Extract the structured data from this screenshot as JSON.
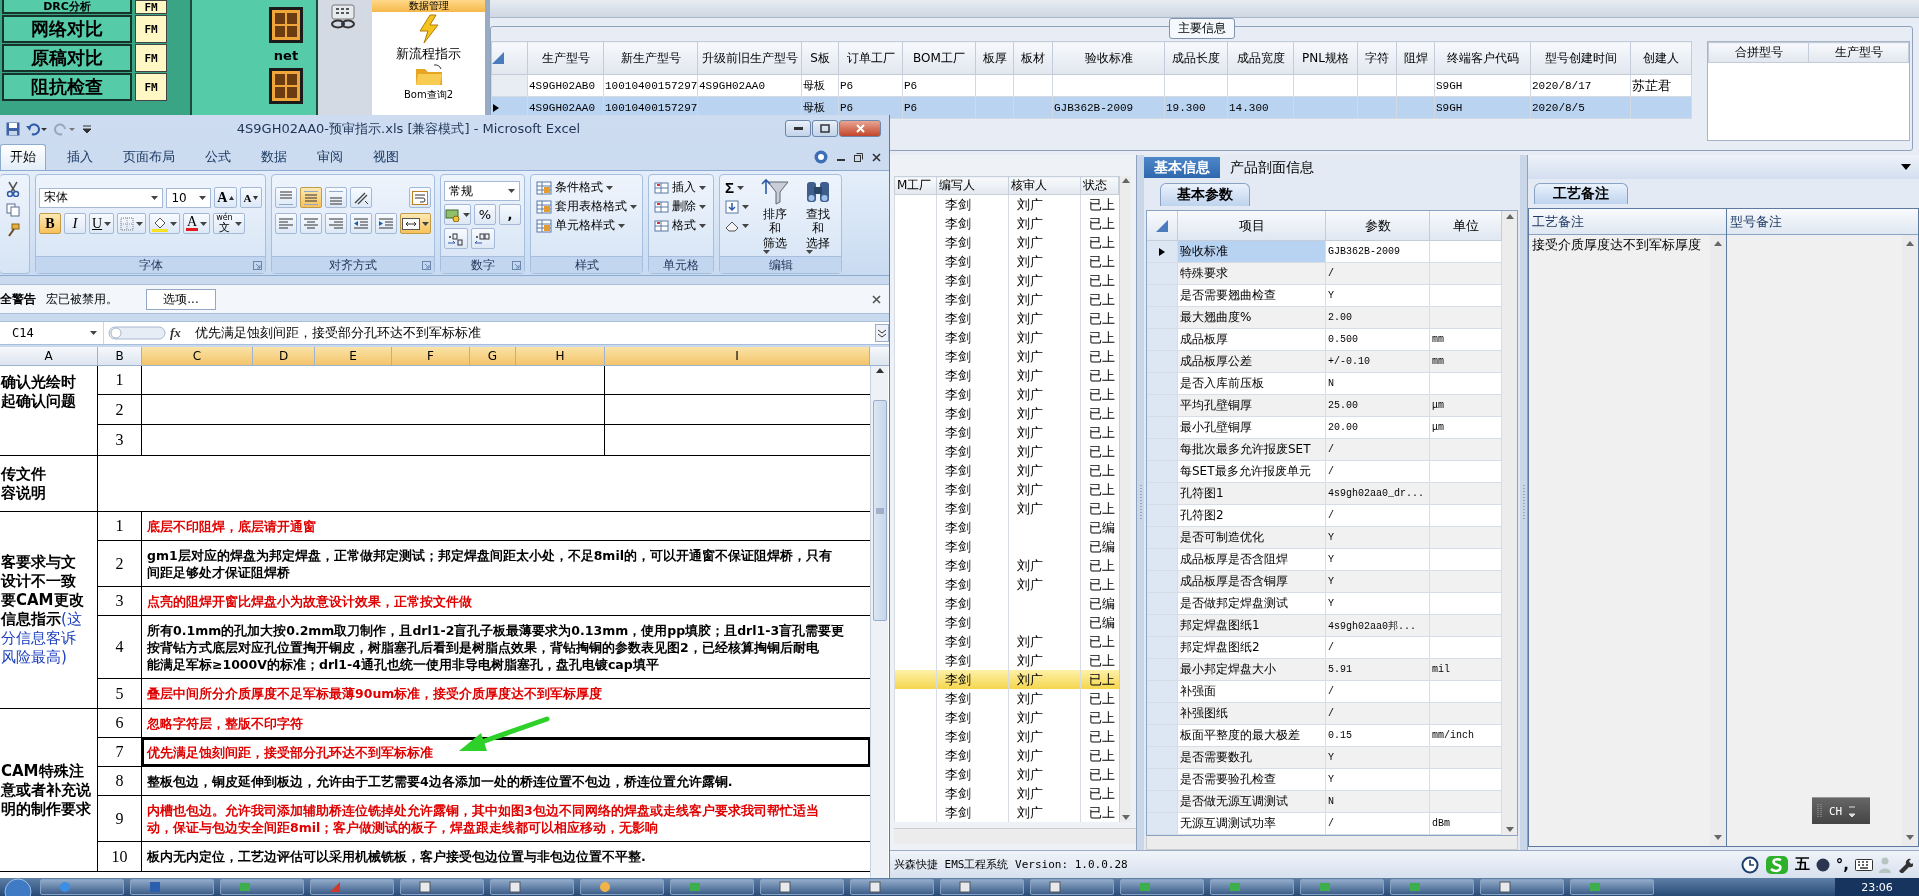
{
  "nav": {
    "items": [
      {
        "label": "DRC分析",
        "badge": "FM"
      },
      {
        "label": "网络对比",
        "badge": "FM"
      },
      {
        "label": "原稿对比",
        "badge": "FM"
      },
      {
        "label": "阻抗检查",
        "badge": "FM"
      }
    ]
  },
  "net_panel": {
    "label": "net"
  },
  "function_menu": {
    "header": "数据管理",
    "items": [
      {
        "label": "新流程指示",
        "kind": "flow"
      },
      {
        "label": "Bom查询2",
        "kind": "folder"
      }
    ]
  },
  "main_info": {
    "title": "主要信息",
    "columns": [
      "生产型号",
      "新生产型号",
      "升级前旧生产型号",
      "S板",
      "订单工厂",
      "BOM工厂",
      "板厚",
      "板材",
      "验收标准",
      "成品长度",
      "成品宽度",
      "PNL规格",
      "字符",
      "阻焊",
      "终端客户代码",
      "型号创建时间",
      "创建人"
    ],
    "rows": [
      {
        "selected": false,
        "cells": [
          "4S9GH02AB0",
          "10010400157297",
          "4S9GH02AA0",
          "母板",
          "P6",
          "P6",
          null,
          null,
          null,
          null,
          null,
          null,
          null,
          null,
          "S9GH",
          "2020/8/17",
          "苏芷君"
        ]
      },
      {
        "selected": true,
        "cells": [
          "4S9GH02AA0",
          "10010400157297",
          null,
          "母板",
          "P6",
          "P6",
          null,
          null,
          "GJB362B-2009",
          "19.300",
          "14.300",
          null,
          null,
          null,
          "S9GH",
          "2020/8/5",
          null
        ]
      }
    ]
  },
  "merge_panel": {
    "columns": [
      "合拼型号",
      "生产型号"
    ]
  },
  "list": {
    "columns": [
      "M工厂",
      "编写人",
      "核审人",
      "状态"
    ],
    "rows": [
      {
        "writer": "李剑",
        "reviewer": "刘广",
        "status": "已上",
        "selected": false
      },
      {
        "writer": "李剑",
        "reviewer": "刘广",
        "status": "已上",
        "selected": false
      },
      {
        "writer": "李剑",
        "reviewer": "刘广",
        "status": "已上",
        "selected": false
      },
      {
        "writer": "李剑",
        "reviewer": "刘广",
        "status": "已上",
        "selected": false
      },
      {
        "writer": "李剑",
        "reviewer": "刘广",
        "status": "已上",
        "selected": false
      },
      {
        "writer": "李剑",
        "reviewer": "刘广",
        "status": "已上",
        "selected": false
      },
      {
        "writer": "李剑",
        "reviewer": "刘广",
        "status": "已上",
        "selected": false
      },
      {
        "writer": "李剑",
        "reviewer": "刘广",
        "status": "已上",
        "selected": false
      },
      {
        "writer": "李剑",
        "reviewer": "刘广",
        "status": "已上",
        "selected": false
      },
      {
        "writer": "李剑",
        "reviewer": "刘广",
        "status": "已上",
        "selected": false
      },
      {
        "writer": "李剑",
        "reviewer": "刘广",
        "status": "已上",
        "selected": false
      },
      {
        "writer": "李剑",
        "reviewer": "刘广",
        "status": "已上",
        "selected": false
      },
      {
        "writer": "李剑",
        "reviewer": "刘广",
        "status": "已上",
        "selected": false
      },
      {
        "writer": "李剑",
        "reviewer": "刘广",
        "status": "已上",
        "selected": false
      },
      {
        "writer": "李剑",
        "reviewer": "刘广",
        "status": "已上",
        "selected": false
      },
      {
        "writer": "李剑",
        "reviewer": "刘广",
        "status": "已上",
        "selected": false
      },
      {
        "writer": "李剑",
        "reviewer": "刘广",
        "status": "已上",
        "selected": false
      },
      {
        "writer": "李剑",
        "status": "已编",
        "selected": false
      },
      {
        "writer": "李剑",
        "status": "已编",
        "selected": false
      },
      {
        "writer": "李剑",
        "reviewer": "刘广",
        "status": "已上",
        "selected": false
      },
      {
        "writer": "李剑",
        "reviewer": "刘广",
        "status": "已上",
        "selected": false
      },
      {
        "writer": "李剑",
        "status": "已编",
        "selected": false
      },
      {
        "writer": "李剑",
        "status": "已编",
        "selected": false
      },
      {
        "writer": "李剑",
        "reviewer": "刘广",
        "status": "已上",
        "selected": false
      },
      {
        "writer": "李剑",
        "reviewer": "刘广",
        "status": "已上",
        "selected": false
      },
      {
        "writer": "李剑",
        "reviewer": "刘广",
        "status": "已上",
        "selected": true
      },
      {
        "writer": "李剑",
        "reviewer": "刘广",
        "status": "已上",
        "selected": false
      },
      {
        "writer": "李剑",
        "reviewer": "刘广",
        "status": "已上",
        "selected": false
      },
      {
        "writer": "李剑",
        "reviewer": "刘广",
        "status": "已上",
        "selected": false
      },
      {
        "writer": "李剑",
        "reviewer": "刘广",
        "status": "已上",
        "selected": false
      },
      {
        "writer": "李剑",
        "reviewer": "刘广",
        "status": "已上",
        "selected": false
      },
      {
        "writer": "李剑",
        "reviewer": "刘广",
        "status": "已上",
        "selected": false
      },
      {
        "writer": "李剑",
        "reviewer": "刘广",
        "status": "已上",
        "selected": false
      }
    ]
  },
  "info_tabs": [
    {
      "label": "基本信息",
      "selected": true
    },
    {
      "label": "产品剖面信息",
      "selected": false
    }
  ],
  "params": {
    "tab": "基本参数",
    "columns": [
      "项目",
      "参数",
      "单位"
    ],
    "rows": [
      {
        "item": "验收标准",
        "value": "GJB362B-2009",
        "selected": true
      },
      {
        "item": "特殊要求",
        "value": "/",
        "selected": false
      },
      {
        "item": "是否需要翘曲检查",
        "value": "Y",
        "selected": false
      },
      {
        "item": "最大翘曲度%",
        "value": "2.00",
        "selected": false
      },
      {
        "item": "成品板厚",
        "value": "0.500",
        "unit": "mm",
        "selected": false
      },
      {
        "item": "成品板厚公差",
        "value": "+/-0.10",
        "unit": "mm",
        "selected": false
      },
      {
        "item": "是否入库前压板",
        "value": "N",
        "selected": false
      },
      {
        "item": "平均孔壁铜厚",
        "value": "25.00",
        "unit": "μm",
        "selected": false
      },
      {
        "item": "最小孔壁铜厚",
        "value": "20.00",
        "unit": "μm",
        "selected": false
      },
      {
        "item": "每批次最多允许报废SET",
        "value": "/",
        "selected": false
      },
      {
        "item": "每SET最多允许报废单元",
        "value": "/",
        "selected": false
      },
      {
        "item": "孔符图1",
        "value": "4s9gh02aa0_dr...",
        "selected": false
      },
      {
        "item": "孔符图2",
        "value": "/",
        "selected": false
      },
      {
        "item": "是否可制造优化",
        "value": "Y",
        "selected": false
      },
      {
        "item": "成品板厚是否含阻焊",
        "value": "Y",
        "selected": false
      },
      {
        "item": "成品板厚是否含铜厚",
        "value": "Y",
        "selected": false
      },
      {
        "item": "是否做邦定焊盘测试",
        "value": "Y",
        "selected": false
      },
      {
        "item": "邦定焊盘图纸1",
        "value": "4s9gh02aa0邦...",
        "selected": false
      },
      {
        "item": "邦定焊盘图纸2",
        "value": "/",
        "selected": false
      },
      {
        "item": "最小邦定焊盘大小",
        "value": "5.91",
        "unit": "mil",
        "selected": false
      },
      {
        "item": "补强面",
        "value": "/",
        "selected": false
      },
      {
        "item": "补强图纸",
        "value": "/",
        "selected": false
      },
      {
        "item": "板面平整度的最大极差",
        "value": "0.15",
        "unit": "mm/inch",
        "selected": false
      },
      {
        "item": "是否需要数孔",
        "value": "Y",
        "selected": false
      },
      {
        "item": "是否需要验孔检查",
        "value": "Y",
        "selected": false
      },
      {
        "item": "是否做无源互调测试",
        "value": "N",
        "selected": false
      },
      {
        "item": "无源互调测试功率",
        "value": "/",
        "unit": "dBm",
        "selected": false
      }
    ]
  },
  "notes": {
    "tab": "工艺备注",
    "columns": [
      "工艺备注",
      "型号备注"
    ],
    "process_note": "接受介质厚度达不到军标厚度"
  },
  "ime": {
    "label": "CH"
  },
  "status_bar": {
    "text": "兴森快捷 EMS工程系统 Version: 1.0.0.28",
    "tray": [
      "五",
      "°,"
    ]
  },
  "taskbar": {
    "clock": "23:06"
  },
  "excel": {
    "title": "4S9GH02AA0-预审指示.xls [兼容模式] - Microsoft Excel",
    "tabs": [
      {
        "label": "开始",
        "selected": true
      },
      {
        "label": "插入",
        "selected": false
      },
      {
        "label": "页面布局",
        "selected": false
      },
      {
        "label": "公式",
        "selected": false
      },
      {
        "label": "数据",
        "selected": false
      },
      {
        "label": "审阅",
        "selected": false
      },
      {
        "label": "视图",
        "selected": false
      }
    ],
    "font": {
      "label": "字体",
      "name": "宋体",
      "size": "10",
      "grow": "A",
      "shrink": "A",
      "font_color": "A",
      "bold": {
        "label": "B",
        "selected": true
      },
      "italic": {
        "label": "I",
        "selected": false
      },
      "underline": {
        "label": "U",
        "selected": false
      },
      "phonetic": {
        "top": "wén",
        "bottom": "文"
      }
    },
    "alignment": {
      "label": "对齐方式",
      "rows": [
        [
          {
            "kind": "top",
            "selected": false
          },
          {
            "kind": "middle",
            "selected": true
          },
          {
            "kind": "bottom",
            "selected": false
          },
          {
            "kind": "orientation",
            "selected": false
          }
        ],
        [
          {
            "kind": "left",
            "selected": false
          },
          {
            "kind": "center",
            "selected": false
          },
          {
            "kind": "right",
            "selected": false
          },
          {
            "kind": "outdent",
            "selected": false
          },
          {
            "kind": "indent",
            "selected": false
          }
        ]
      ],
      "wrap": {
        "selected": false
      },
      "merge": {
        "selected": true
      }
    },
    "number": {
      "label": "数字",
      "format": "常规",
      "percent": "%",
      "comma": ","
    },
    "styles": {
      "label": "样式",
      "items": [
        "条件格式",
        "套用表格格式",
        "单元格样式"
      ]
    },
    "cells": {
      "label": "单元格",
      "items": [
        "插入",
        "删除",
        "格式"
      ]
    },
    "editing": {
      "label": "编辑",
      "sum": "Σ",
      "sort": [
        "排序和",
        "筛选"
      ],
      "find": [
        "查找和",
        "选择"
      ]
    },
    "security": {
      "title": "全警告",
      "message": "宏已被禁用。",
      "button": "选项..."
    },
    "formula_bar": {
      "cell": "C14",
      "fx": "fx",
      "formula": "优先满足蚀刻间距，接受部分孔环达不到军标标准"
    },
    "columns": [
      {
        "label": "A",
        "selected": false
      },
      {
        "label": "B",
        "selected": false
      },
      {
        "label": "C",
        "selected": true
      },
      {
        "label": "D",
        "selected": true
      },
      {
        "label": "E",
        "selected": true
      },
      {
        "label": "F",
        "selected": true
      },
      {
        "label": "G",
        "selected": true
      },
      {
        "label": "H",
        "selected": true
      },
      {
        "label": "I",
        "selected": true
      }
    ],
    "sections": [
      {
        "kind": "grid",
        "heading": [
          "确认光绘时",
          "起确认问题"
        ],
        "rows": [
          {
            "no": "1"
          },
          {
            "no": "2"
          },
          {
            "no": "3"
          }
        ]
      },
      {
        "kind": "merged",
        "heading": [
          "传文件",
          "容说明"
        ]
      },
      {
        "kind": "items",
        "heading": [
          "客要求与文",
          "设计不一致",
          "要CAM更改",
          "信息指示"
        ],
        "note": [
          "(这",
          "分信息客诉",
          "风险最高)"
        ],
        "rows": [
          {
            "no": "1",
            "color": "#e00000",
            "selected": false,
            "lines": [
              "底层不印阻焊，底层请开通窗"
            ]
          },
          {
            "no": "2",
            "color": "#000000",
            "selected": false,
            "lines": [
              "gm1层对应的焊盘为邦定焊盘，正常做邦定测试；邦定焊盘间距太小处，不足8mil的，可以开通窗不保证阻焊桥，只有",
              "间距足够处才保证阻焊桥"
            ]
          },
          {
            "no": "3",
            "color": "#e00000",
            "selected": false,
            "lines": [
              "点亮的阻焊开窗比焊盘小为故意设计效果，正常按文件做"
            ]
          },
          {
            "no": "4",
            "color": "#000000",
            "selected": false,
            "lines": [
              "所有0.1mm的孔加大按0.2mm取刀制作，且drl1-2盲孔子板最薄要求为0.13mm，使用pp填胶；且drl1-3盲孔需要更",
              "按背钻方式底层对应孔位置掏开铜皮，树脂塞孔后看到是树脂点效果，背钻掏铜的参数表见图2，已经核算掏铜后耐电",
              "能满足军标≥1000V的标准；drl1-4通孔也统一使用非导电树脂塞孔，盘孔电镀cap填平"
            ]
          },
          {
            "no": "5",
            "color": "#e00000",
            "selected": false,
            "lines": [
              "叠层中间所分介质厚度不足军标最薄90um标准，接受介质厚度达不到军标厚度"
            ]
          }
        ]
      },
      {
        "kind": "items",
        "heading": [
          "CAM特殊注",
          "意或者补充说",
          "明的制作要求"
        ],
        "rows": [
          {
            "no": "6",
            "color": "#e00000",
            "selected": false,
            "lines": [
              "忽略字符层，整版不印字符"
            ]
          },
          {
            "no": "7",
            "color": "#e00000",
            "selected": true,
            "lines": [
              "优先满足蚀刻间距，接受部分孔环达不到军标标准"
            ]
          },
          {
            "no": "8",
            "color": "#000000",
            "selected": false,
            "lines": [
              "整板包边，铜皮延伸到板边，允许由于工艺需要4边各添加一处的桥连位置不包边，桥连位置允许露铜."
            ]
          },
          {
            "no": "9",
            "color": "#e00000",
            "selected": false,
            "lines": [
              "内槽也包边。允许我司添加辅助桥连位铣掉处允许露铜，其中如图3包边不同网络的焊盘或走线客户要求我司帮忙适当",
              "动，保证与包边安全间距8mil；客户做测试的板子，焊盘跟走线都可以相应移动，无影响"
            ]
          },
          {
            "no": "10",
            "color": "#000000",
            "selected": false,
            "lines": [
              "板内无内定位，工艺边评估可以采用机械铣板，客户接受包边位置与非包边位置不平整."
            ]
          }
        ]
      }
    ]
  }
}
